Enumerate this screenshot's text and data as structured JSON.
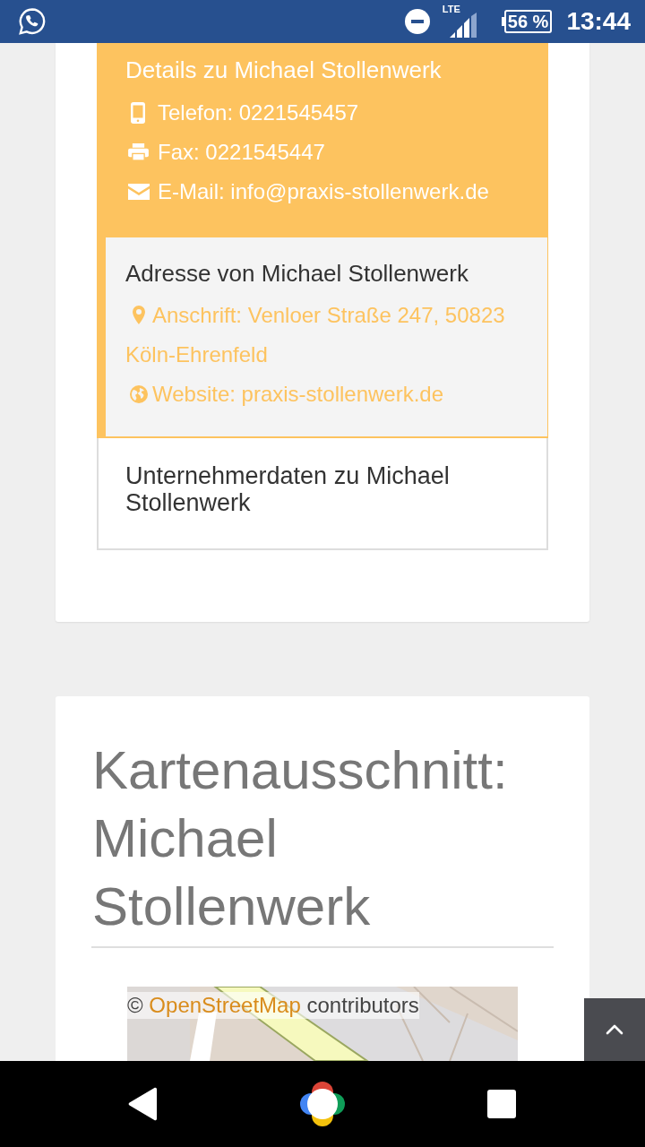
{
  "status_bar": {
    "network": "LTE",
    "battery": "56 %",
    "time": "13:44"
  },
  "sections": [
    {
      "kind": "highlight",
      "title": "Details zu Michael Stollenwerk",
      "items": [
        {
          "kind": "phone",
          "text": "Telefon: 0221545457"
        },
        {
          "kind": "fax",
          "text": "Fax: 0221545447"
        },
        {
          "kind": "email",
          "text": "E-Mail: info@praxis-stollenwerk.de"
        }
      ]
    },
    {
      "kind": "accent",
      "title": "Adresse von Michael Stollenwerk",
      "items": [
        {
          "kind": "address",
          "text": "Anschrift: Venloer Straße 247, 50823 Köln-Ehrenfeld"
        },
        {
          "kind": "website",
          "text": "Website: praxis-stollenwerk.de"
        }
      ]
    },
    {
      "kind": "plain",
      "title": "Unternehmerdaten zu Michael Stollenwerk"
    }
  ],
  "map_section": {
    "heading": "Kartenausschnitt: Michael Stollenwerk",
    "attribution": {
      "prefix": "©",
      "link": "OpenStreetMap",
      "suffix": "contributors"
    }
  }
}
